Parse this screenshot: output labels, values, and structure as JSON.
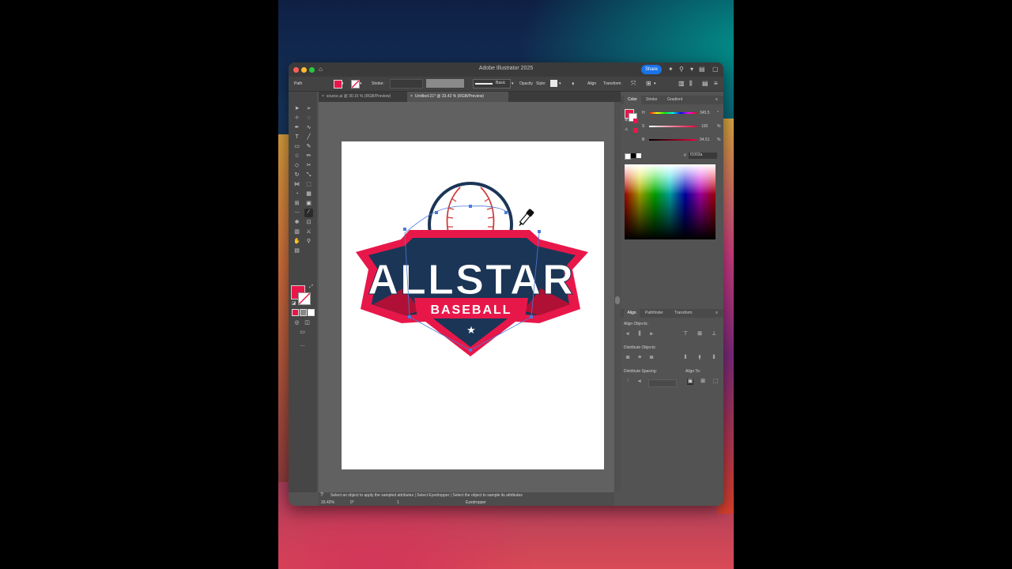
{
  "app": {
    "title": "Adobe Illustrator 2025",
    "share_label": "Share"
  },
  "control_bar": {
    "selection": "Path",
    "stroke_label": "Stroke:",
    "brush_label": "Basic",
    "opacity_label": "Opacity",
    "style_label": "Style:",
    "align_label": "Align",
    "transform_label": "Transform"
  },
  "tabs": [
    {
      "label": "source.ai @ 30.15 % (RGB/Preview)",
      "active": false
    },
    {
      "label": "Untitled-21* @ 33.42 % (RGB/Preview)",
      "active": true
    }
  ],
  "artwork": {
    "title": "ALLSTAR",
    "subtitle": "BASEBALL",
    "star": "★"
  },
  "color_panel": {
    "tabs": [
      "Color",
      "Stroke",
      "Gradient"
    ],
    "channels": [
      {
        "label": "H",
        "value": "345.5",
        "unit": "°"
      },
      {
        "label": "S",
        "value": "100",
        "unit": "%"
      },
      {
        "label": "B",
        "value": "94.51",
        "unit": "%"
      }
    ],
    "hex_prefix": "#",
    "hex": "f1003a",
    "fill_color": "#f1003a"
  },
  "align_panel": {
    "tabs": [
      "Align",
      "Pathfinder",
      "Transform"
    ],
    "align_objects": "Align Objects:",
    "distribute_objects": "Distribute Objects:",
    "distribute_spacing": "Distribute Spacing:",
    "align_to": "Align To:"
  },
  "status_bar": {
    "hint": "Select an object to apply the sampled attributes  |  Select Eyedropper  |  Select the object to sample its attributes",
    "zoom": "33.42%",
    "rotation": "0°",
    "artboard_num": "1",
    "tool_name": "Eyedropper"
  },
  "colors": {
    "accent_red": "#e8174a",
    "navy": "#1b3556",
    "dark_red": "#b01035",
    "selection_blue": "#4a7bd9"
  }
}
